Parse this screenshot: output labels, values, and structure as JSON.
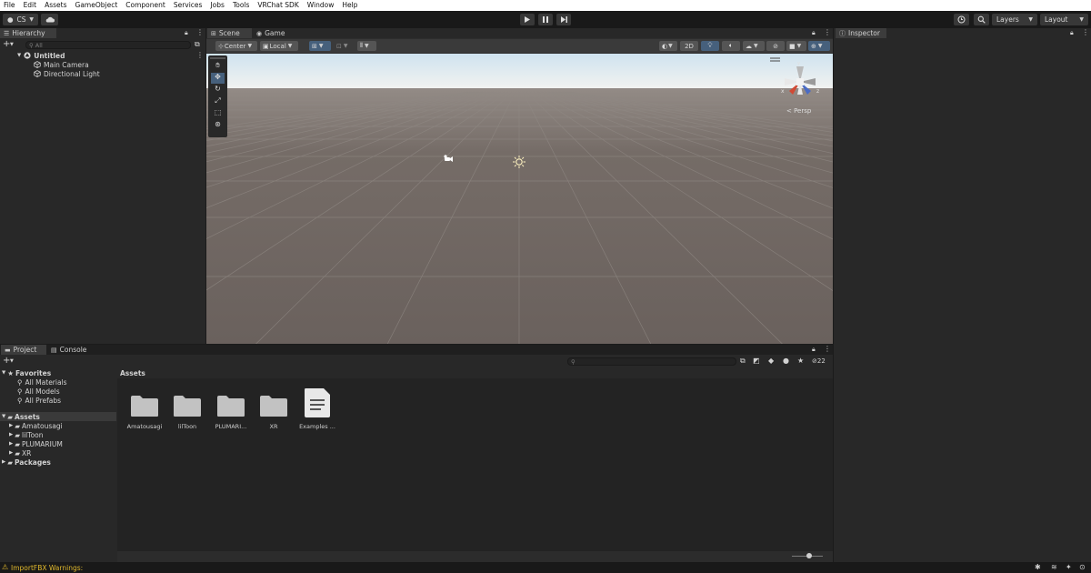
{
  "menu": [
    "File",
    "Edit",
    "Assets",
    "GameObject",
    "Component",
    "Services",
    "Jobs",
    "Tools",
    "VRChat SDK",
    "Window",
    "Help"
  ],
  "toolbar": {
    "account": "CS",
    "layers": "Layers",
    "layout": "Layout"
  },
  "hierarchy": {
    "tab": "Hierarchy",
    "search_placeholder": "All",
    "scene_name": "Untitled",
    "items": [
      "Main Camera",
      "Directional Light"
    ]
  },
  "scene": {
    "tabs": [
      "Scene",
      "Game"
    ],
    "pivot": "Center",
    "space": "Local",
    "mode_2d": "2D",
    "gizmo_label": "< Persp"
  },
  "inspector": {
    "tab": "Inspector"
  },
  "project": {
    "tabs": [
      "Project",
      "Console"
    ],
    "hidden_count": "22",
    "favorites_label": "Favorites",
    "favorites": [
      "All Materials",
      "All Models",
      "All Prefabs"
    ],
    "assets_label": "Assets",
    "asset_folders": [
      "Amatousagi",
      "lilToon",
      "PLUMARIUM",
      "XR"
    ],
    "packages_label": "Packages",
    "breadcrumb": "Assets",
    "grid_items": [
      "Amatousagi",
      "lilToon",
      "PLUMARI...",
      "XR",
      "Examples ..."
    ]
  },
  "status": {
    "warning": "ImportFBX Warnings:"
  },
  "colors": {
    "accent_blue": "#46607c",
    "sky_top": "#cfe3ef",
    "ground": "#6e6561",
    "warning": "#e0b82c"
  }
}
